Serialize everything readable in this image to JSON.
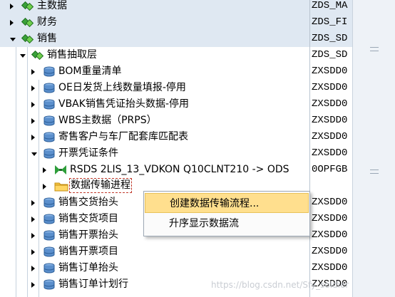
{
  "tree": [
    {
      "label": "主数据",
      "code": "ZDS_MA",
      "icon": "diamond-icon",
      "level": 1,
      "state": "collapsed",
      "header": true
    },
    {
      "label": "财务",
      "code": "ZDS_FI",
      "icon": "diamond-icon",
      "level": 1,
      "state": "collapsed",
      "header": true
    },
    {
      "label": "销售",
      "code": "ZDS_SD",
      "icon": "diamond-icon",
      "level": 1,
      "state": "expanded",
      "header": true
    },
    {
      "label": "销售抽取层",
      "code": "ZDS_SD",
      "icon": "diamond-icon",
      "level": 2,
      "state": "expanded",
      "header": false
    },
    {
      "label": "BOM重量清单",
      "code": "ZXSDD0",
      "icon": "datasource-icon",
      "level": 3,
      "state": "collapsed"
    },
    {
      "label": "OE日发货上线数量填报-停用",
      "code": "ZXSDD0",
      "icon": "datasource-icon",
      "level": 3,
      "state": "collapsed"
    },
    {
      "label": "VBAK销售凭证抬头数据-停用",
      "code": "ZXSDD0",
      "icon": "datasource-icon",
      "level": 3,
      "state": "collapsed"
    },
    {
      "label": "WBS主数据（PRPS）",
      "code": "ZXSDD0",
      "icon": "datasource-icon",
      "level": 3,
      "state": "collapsed"
    },
    {
      "label": "寄售客户与车厂配套库匹配表",
      "code": "ZXSDD0",
      "icon": "datasource-icon",
      "level": 3,
      "state": "collapsed"
    },
    {
      "label": "开票凭证条件",
      "code": "ZXSDD0",
      "icon": "datasource-icon",
      "level": 3,
      "state": "expanded"
    },
    {
      "label": "RSDS 2LIS_13_VDKON Q10CLNT210 -> ODS",
      "code": "0OPFGB",
      "icon": "transformation-icon",
      "level": 4,
      "state": "collapsed"
    },
    {
      "label": "数据传输进程",
      "code": "",
      "icon": "folder-icon",
      "level": 4,
      "state": "collapsed",
      "selected": true
    },
    {
      "label": "销售交货抬头",
      "code": "ZXSDD0",
      "icon": "datasource-icon",
      "level": 3,
      "state": "collapsed"
    },
    {
      "label": "销售交货项目",
      "code": "ZXSDD0",
      "icon": "datasource-icon",
      "level": 3,
      "state": "collapsed"
    },
    {
      "label": "销售开票抬头",
      "code": "ZXSDD0",
      "icon": "datasource-icon",
      "level": 3,
      "state": "collapsed"
    },
    {
      "label": "销售开票项目",
      "code": "ZXSDD0",
      "icon": "datasource-icon",
      "level": 3,
      "state": "collapsed"
    },
    {
      "label": "销售订单抬头",
      "code": "ZXSDD0",
      "icon": "datasource-icon",
      "level": 3,
      "state": "collapsed"
    },
    {
      "label": "销售订单计划行",
      "code": "ZXSDD0",
      "icon": "datasource-icon",
      "level": 3,
      "state": "collapsed"
    }
  ],
  "context_menu": {
    "items": [
      {
        "label": "创建数据传输流程...",
        "highlighted": true
      },
      {
        "label": "升序显示数据流",
        "highlighted": false
      }
    ]
  },
  "watermark": "https://blog.csdn.net/Sfy_soldier",
  "colors": {
    "accent_green": "#2e8b2e",
    "header_row": "#dfe8f2",
    "menu_highlight": "#ffdf8e",
    "folder": "#f5c342",
    "datasource": "#3a6ea5"
  }
}
